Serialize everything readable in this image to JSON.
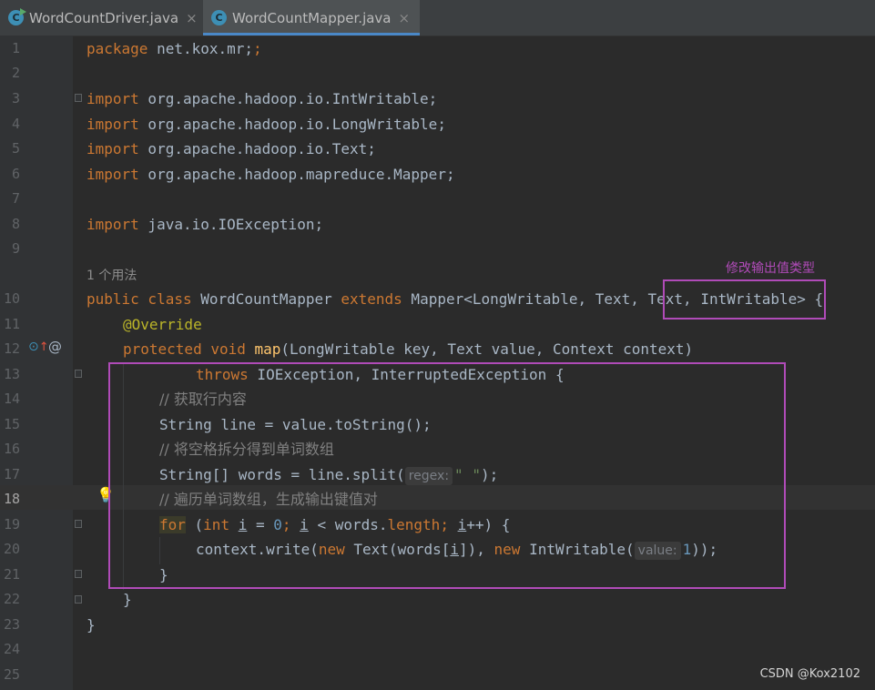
{
  "tabs": [
    {
      "label": "WordCountDriver.java",
      "icon": "java-class-run-icon",
      "close": "×"
    },
    {
      "label": "WordCountMapper.java",
      "icon": "java-class-icon",
      "close": "×",
      "active": true
    }
  ],
  "editor": {
    "usages_hint": "1 个用法",
    "annotation_label": "修改输出值类型",
    "current_line": 18,
    "gutter_icons": {
      "override": "implemented-method-icon",
      "at": "@",
      "bulb": "intention-bulb-icon"
    },
    "lines": {
      "l1": [
        "package",
        " net.kox.mr;"
      ],
      "l3": [
        "import",
        " org.apache.hadoop.io.IntWritable;"
      ],
      "l4": [
        "import",
        " org.apache.hadoop.io.LongWritable;"
      ],
      "l5": [
        "import",
        " org.apache.hadoop.io.Text;"
      ],
      "l6": [
        "import",
        " org.apache.hadoop.mapreduce.Mapper;"
      ],
      "l8": [
        "import",
        " java.io.IOException;"
      ],
      "l10": [
        "public class",
        " WordCountMapper ",
        "extends",
        " Mapper<LongWritable, Text, Text, IntWritable> {"
      ],
      "l11": "@Override",
      "l12": [
        "protected void",
        " ",
        "map",
        "(LongWritable key, Text value, Context context)"
      ],
      "l13": [
        "throws",
        " IOException, InterruptedException {"
      ],
      "l14": "// 获取行内容",
      "l15": "String line = value.toString();",
      "l16": "// 将空格拆分得到单词数组",
      "l17": [
        "String[] words = line.split(",
        "regex:",
        "\" \"",
        ");"
      ],
      "l18": "// 遍历单词数组，生成输出键值对",
      "l19": [
        "for",
        " (",
        "int",
        " ",
        "i",
        " = ",
        "0",
        "; ",
        "i",
        " < words.",
        "length",
        "; ",
        "i",
        "++) {"
      ],
      "l20": [
        "context.write(",
        "new",
        " Text(words[",
        "i",
        "]), ",
        "new",
        " IntWritable(",
        "value:",
        "1",
        "));"
      ],
      "l21": "}",
      "l22": "}",
      "l23": "}"
    }
  },
  "line_numbers": [
    "1",
    "2",
    "3",
    "4",
    "5",
    "6",
    "7",
    "8",
    "9",
    "10",
    "11",
    "12",
    "13",
    "14",
    "15",
    "16",
    "17",
    "18",
    "19",
    "20",
    "21",
    "22",
    "23",
    "24",
    "25"
  ],
  "watermark": "CSDN @Kox2102",
  "colors": {
    "annotation": "#b04bb8",
    "keyword": "#cc7832",
    "accent_tab": "#4a88c7"
  }
}
